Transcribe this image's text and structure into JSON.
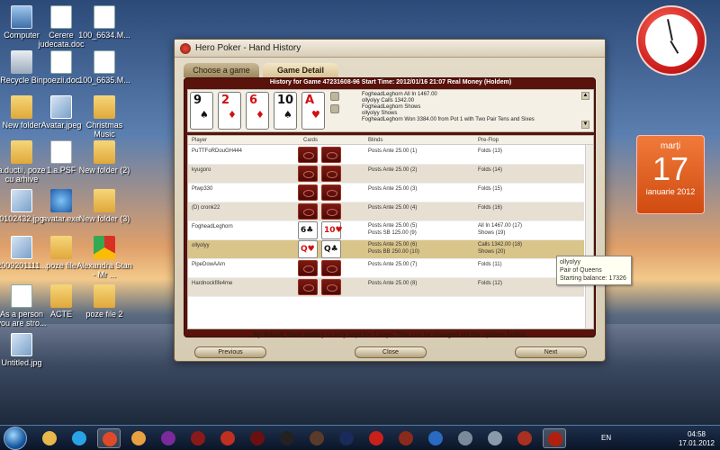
{
  "desktop": {
    "icons": [
      {
        "label": "Computer",
        "kind": "pc"
      },
      {
        "label": "Cerere judecata.doc",
        "kind": "doc"
      },
      {
        "label": "100_6634.M...",
        "kind": "doc"
      },
      {
        "label": "Recycle Bin",
        "kind": "bin"
      },
      {
        "label": "poezii.doc",
        "kind": "doc"
      },
      {
        "label": "100_6635.M...",
        "kind": "doc"
      },
      {
        "label": "New folder",
        "kind": "folder"
      },
      {
        "label": "Avatar.jpeg",
        "kind": "img"
      },
      {
        "label": "Christmas Music",
        "kind": "folder"
      },
      {
        "label": "a.ductii, poze cu arhive",
        "kind": "folder"
      },
      {
        "label": "1.a.PSF",
        "kind": "pdf"
      },
      {
        "label": "New folder (2)",
        "kind": "folder"
      },
      {
        "label": "0102432.jpg",
        "kind": "img"
      },
      {
        "label": "avatar.exe",
        "kind": "ie"
      },
      {
        "label": "New folder (3)",
        "kind": "folder"
      },
      {
        "label": "2009201111...",
        "kind": "img"
      },
      {
        "label": "poze file",
        "kind": "folder"
      },
      {
        "label": "Alexandra Stan - Mr ...",
        "kind": "chrome"
      },
      {
        "label": "As a person you are stro...",
        "kind": "doc"
      },
      {
        "label": "ACTE",
        "kind": "folder"
      },
      {
        "label": "poze file 2",
        "kind": "folder"
      },
      {
        "label": "Untitled.jpg",
        "kind": "img"
      }
    ]
  },
  "clock_gadget": {
    "hour": 4,
    "minute": 58
  },
  "calendar_gadget": {
    "day_name": "marți",
    "day": "17",
    "month_year": "ianuarie 2012"
  },
  "window": {
    "title": "Hero Poker - Hand History",
    "tabs": [
      {
        "label": "Choose a game",
        "active": false
      },
      {
        "label": "Game Detail",
        "active": true
      }
    ],
    "history_header": "History for Game 47231608-96 Start Time: 2012/01/16 21:07 Real Money (Holdem)",
    "board_cards": [
      {
        "rank": "9",
        "suit": "♠",
        "color": "black"
      },
      {
        "rank": "2",
        "suit": "♦",
        "color": "red"
      },
      {
        "rank": "6",
        "suit": "♦",
        "color": "red"
      },
      {
        "rank": "10",
        "suit": "♠",
        "color": "black"
      },
      {
        "rank": "A",
        "suit": "♥",
        "color": "red"
      }
    ],
    "log_lines": [
      "FogheadLeghorn All In 1467.00",
      "ollyolyy Calls 1342.00",
      "FogheadLeghorn Shows",
      "ollyolyy Shows",
      "FogheadLeghorn Won 3384.00 from Pot 1 with Two Pair Tens and Sixes"
    ],
    "table": {
      "headers": {
        "player": "Player",
        "cards": "Cards",
        "blinds": "Blinds",
        "preflop": "Pre-Flop"
      },
      "rows": [
        {
          "player": "PuTTFoRDouGH444",
          "blinds": "Posts Ante 25.00 (1)",
          "preflop": "Folds (13)",
          "cards": "back"
        },
        {
          "player": "kyugoro",
          "blinds": "Posts Ante 25.00 (2)",
          "preflop": "Folds (14)",
          "cards": "back"
        },
        {
          "player": "Ptwp330",
          "blinds": "Posts Ante 25.00 (3)",
          "preflop": "Folds (15)",
          "cards": "back"
        },
        {
          "player": "(D)  cronk22",
          "blinds": "Posts Ante 25.00 (4)",
          "preflop": "Folds (16)",
          "cards": "back"
        },
        {
          "player": "FogheadLeghorn",
          "blinds": "Posts Ante 25.00 (5)",
          "blinds2": "Posts SB 125.00 (9)",
          "preflop": "All In 1467.00 (17)",
          "preflop2": "Shows (19)",
          "cards": "shown",
          "card1": {
            "rank": "6",
            "suit": "♣",
            "color": "black"
          },
          "card2": {
            "rank": "10",
            "suit": "♥",
            "color": "red"
          }
        },
        {
          "player": "ollyolyy",
          "blinds": "Posts Ante 25.00 (6)",
          "blinds2": "Posts BB 250.00 (10)",
          "preflop": "Calls 1342.00 (18)",
          "preflop2": "Shows (20)",
          "cards": "shown",
          "card1": {
            "rank": "Q",
            "suit": "♥",
            "color": "red"
          },
          "card2": {
            "rank": "Q",
            "suit": "♣",
            "color": "black"
          },
          "selected": true
        },
        {
          "player": "PipeDowAAm",
          "blinds": "Posts Ante 25.00 (7)",
          "preflop": "Folds (11)",
          "cards": "back"
        },
        {
          "player": "Hardnockfife4me",
          "blinds": "Posts Ante 25.00 (8)",
          "preflop": "Folds (12)",
          "cards": "back"
        }
      ]
    },
    "footnote": "By default, hand history is only kept for 7 days. This can be changed via the options button.",
    "buttons": {
      "previous": "Previous",
      "close": "Close",
      "next": "Next"
    }
  },
  "tooltip": {
    "name": "ollyolyy",
    "hand": "Pair of Queens",
    "balance": "Starting balance: 17326"
  },
  "taskbar": {
    "lang": "EN",
    "time": "04:58",
    "date": "17.01.2012",
    "apps": [
      "explorer",
      "skype",
      "chrome",
      "tumblr",
      "yahoo",
      "poker1",
      "poker2",
      "poker3",
      "fulltilt",
      "pokerstars2",
      "poker4",
      "pokerstars",
      "poker5",
      "kbs",
      "webcam",
      "calculator",
      "poker6",
      "heropoker"
    ]
  },
  "colors": {
    "window_bg": "#d6ccb4",
    "panel": "#5a120c",
    "selected_row": "#d9c48a",
    "red_suit": "#d01010"
  }
}
